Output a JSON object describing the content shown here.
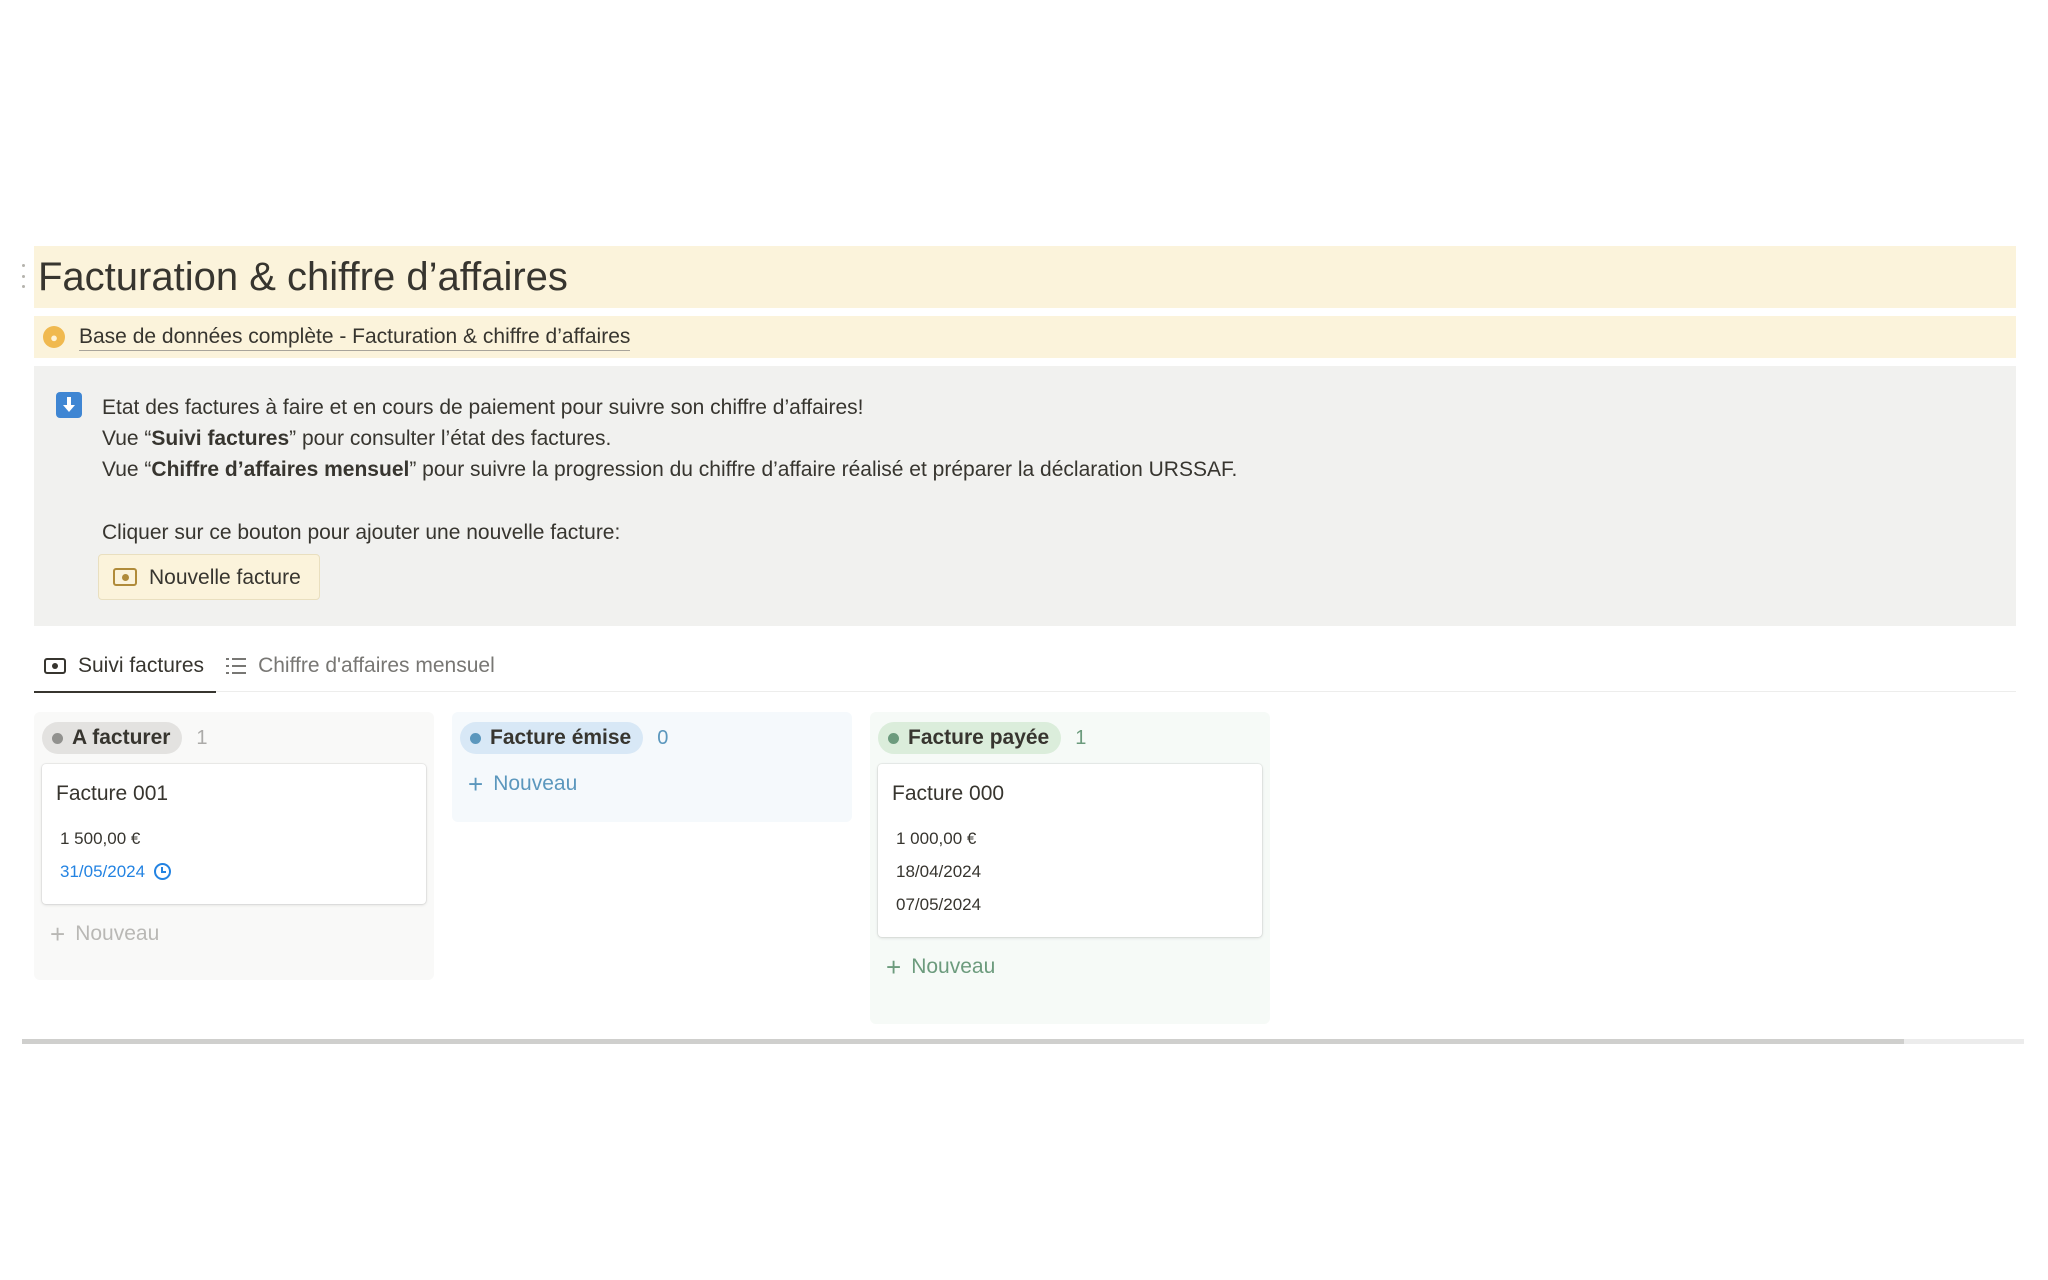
{
  "page": {
    "title": "Facturation & chiffre d’affaires",
    "database_link": "Base de données complète - Facturation & chiffre d’affaires"
  },
  "callout": {
    "line1": "Etat des factures à faire et en cours de paiement pour suivre son chiffre d’affaires!",
    "line2_prefix": "Vue “",
    "line2_bold": "Suivi factures",
    "line2_suffix": "” pour consulter l’état des factures.",
    "line3_prefix": "Vue “",
    "line3_bold": "Chiffre d’affaires mensuel",
    "line3_suffix": "” pour suivre la progression du chiffre d’affaire réalisé et préparer la déclaration URSSAF.",
    "line4": "Cliquer sur ce bouton pour ajouter une nouvelle facture:",
    "button_label": "Nouvelle facture"
  },
  "tabs": [
    {
      "label": "Suivi factures",
      "icon": "cash-icon",
      "active": true
    },
    {
      "label": "Chiffre d'affaires mensuel",
      "icon": "list-icon",
      "active": false
    }
  ],
  "board": {
    "columns": [
      {
        "label": "A facturer",
        "count": "1",
        "colors": {
          "bg": "#f9f9f8",
          "pill": "#e3e2e0",
          "dot": "#91918e",
          "count": "#acaba9",
          "add": "#b9b8b5"
        },
        "cards": [
          {
            "title": "Facture 001",
            "amount": "1 500,00 €",
            "due_date": "31/05/2024"
          }
        ],
        "add_label": "Nouveau"
      },
      {
        "label": "Facture émise",
        "count": "0",
        "colors": {
          "bg": "#f5f9fc",
          "pill": "#d8e8f6",
          "dot": "#5b97bd",
          "count": "#5b97bd",
          "add": "#5b97bd"
        },
        "cards": [],
        "add_label": "Nouveau"
      },
      {
        "label": "Facture payée",
        "count": "1",
        "colors": {
          "bg": "#f6faf7",
          "pill": "#dbeddb",
          "dot": "#6c9b7d",
          "count": "#6c9b7d",
          "add": "#6c9b7d"
        },
        "cards": [
          {
            "title": "Facture 000",
            "amount": "1 000,00 €",
            "date1": "18/04/2024",
            "date2": "07/05/2024"
          }
        ],
        "add_label": "Nouveau"
      }
    ]
  }
}
